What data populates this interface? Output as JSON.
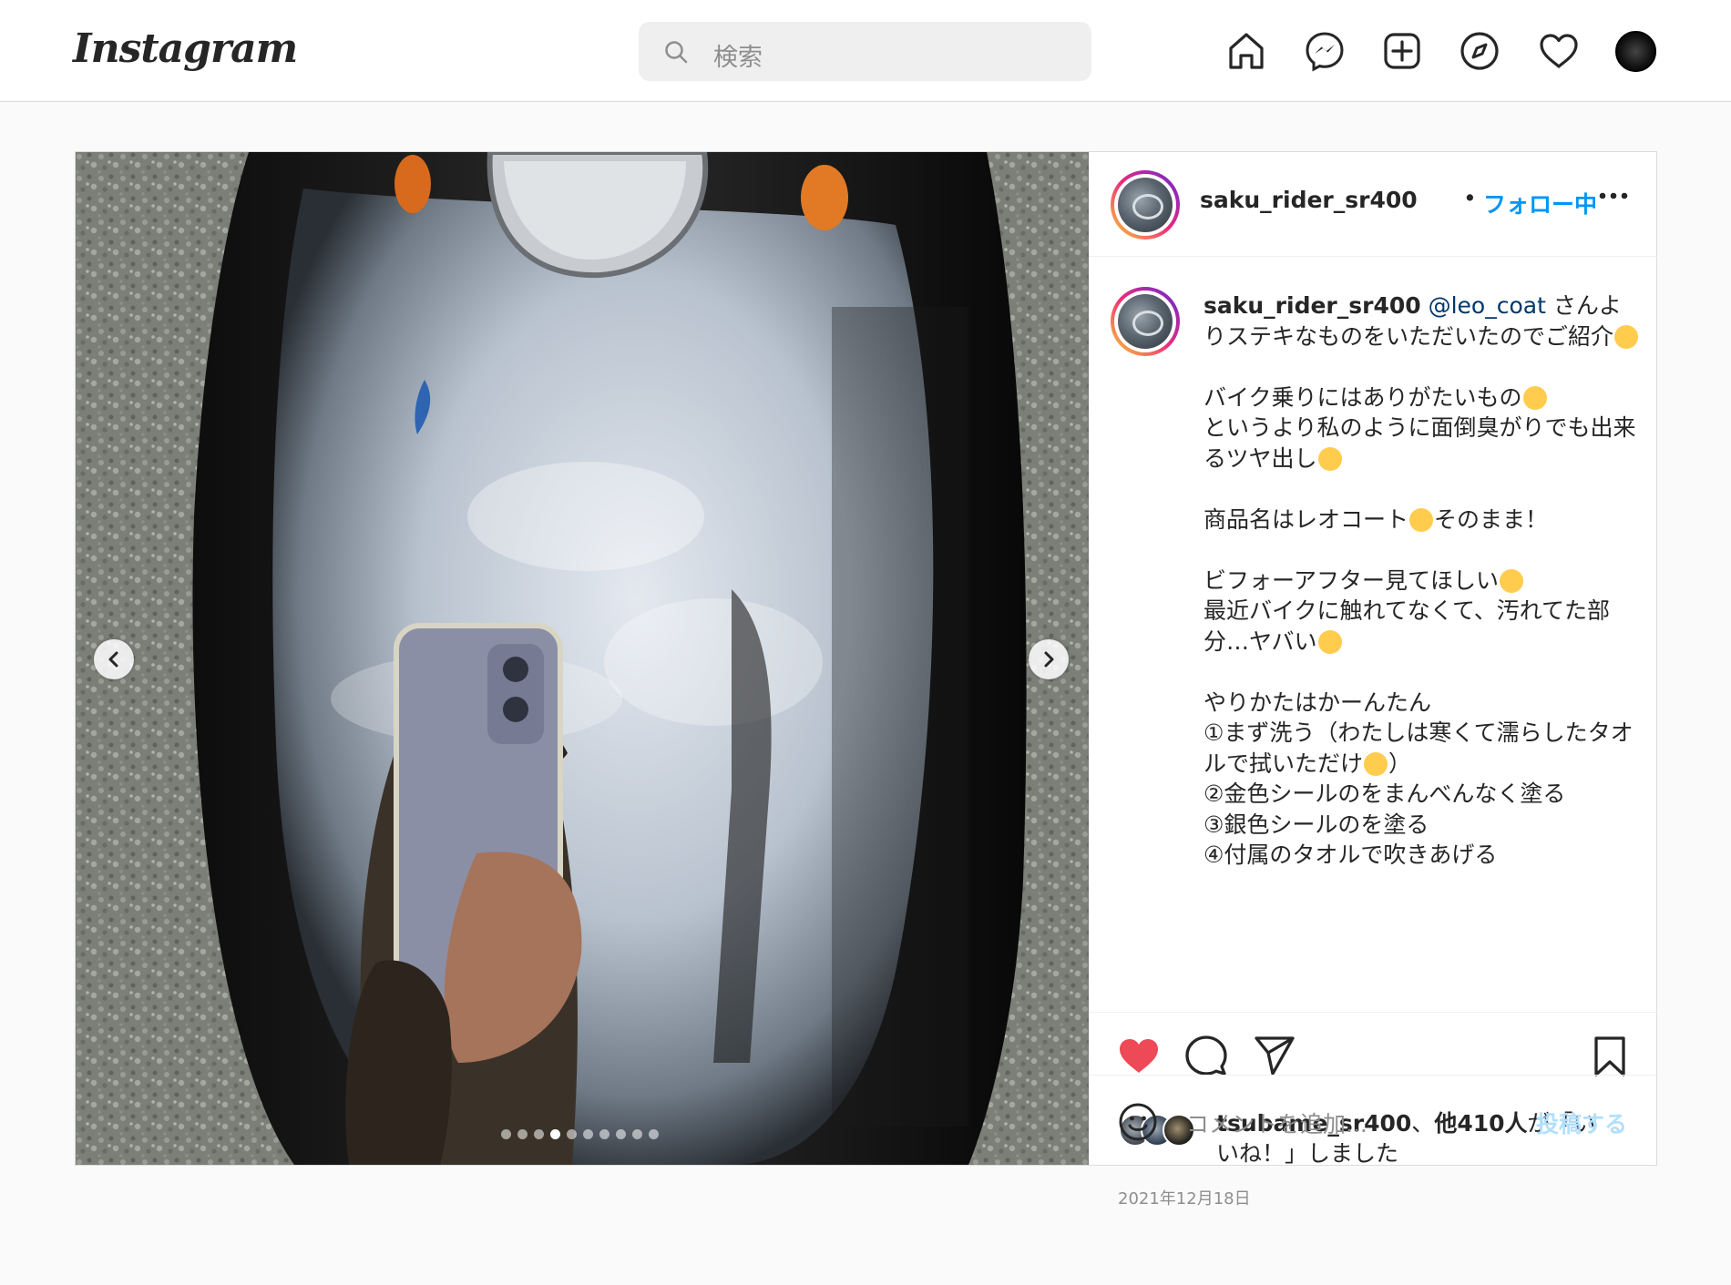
{
  "app": {
    "logo_text": "Instagram",
    "search_placeholder": "検索"
  },
  "nav": {
    "icons": [
      "home-icon",
      "messenger-icon",
      "new-post-icon",
      "explore-icon",
      "activity-heart-icon",
      "profile-avatar"
    ]
  },
  "post": {
    "username": "saku_rider_sr400",
    "separator": "•",
    "follow_status": "フォロー中",
    "more_icon": "more-options-icon",
    "carousel": {
      "slide_count": 10,
      "active_index": 3
    },
    "caption": {
      "username": "saku_rider_sr400",
      "mention": "@leo_coat",
      "line1_rest": " さんよりステキなものをいただいたのでご紹介",
      "para2_line1": "バイク乗りにはありがたいもの",
      "para2_line2": "というより私のように面倒臭がりでも出来るツヤ出し",
      "para3": "商品名はレオコート",
      "para3_end": "そのまま！",
      "para4_line1": "ビフォーアフター見てほしい",
      "para4_line2": "最近バイクに触れてなくて、汚れてた部分…ヤバい",
      "para5_line1": "やりかたはかーんたん",
      "para5_line2": "①まず洗う（わたしは寒くて濡らしたタオルで拭いただけ",
      "para5_line2_end": "）",
      "para5_line3": "②金色シールのをまんべんなく塗る",
      "para5_line4": "③銀色シールのを塗る",
      "para5_line5": "④付属のタオルで吹きあげる"
    },
    "likes": {
      "first_liker": "tsubame_sr400",
      "joiner": "、",
      "others": "他410人",
      "suffix": "が「いいね！」しました"
    },
    "date": "2021年12月18日",
    "comment": {
      "placeholder": "コメントを追加...",
      "post_label": "投稿する"
    },
    "colors": {
      "like_red": "#ed4956",
      "follow_blue": "#0095f6",
      "post_disabled_blue": "#b2dffc"
    }
  }
}
